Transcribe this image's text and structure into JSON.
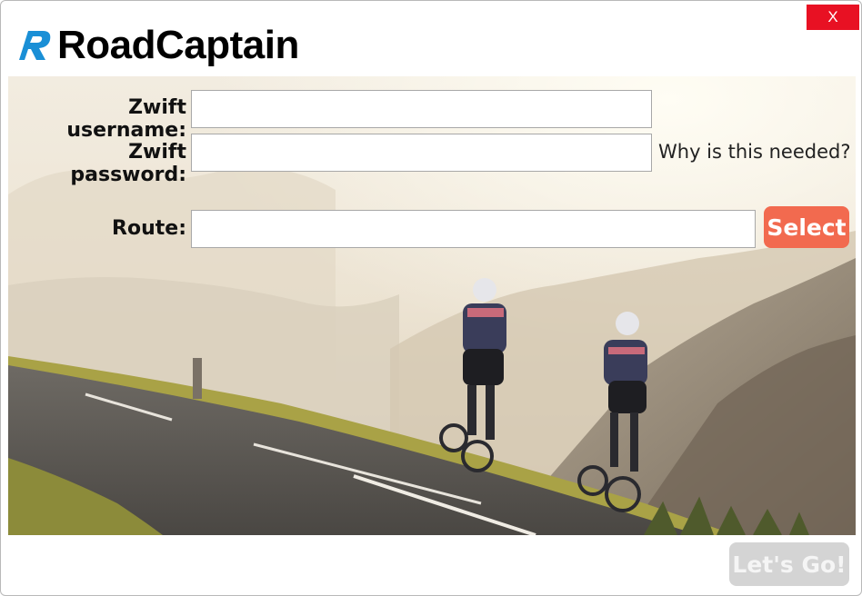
{
  "window": {
    "close_label": "X"
  },
  "brand": {
    "name": "RoadCaptain",
    "logo_icon": "roadcaptain-r-logo",
    "logo_color": "#1a8fd6"
  },
  "form": {
    "username_label": "Zwift username:",
    "username_value": "",
    "password_label": "Zwift password:",
    "password_value": "",
    "why_link": "Why is this needed?",
    "route_label": "Route:",
    "route_value": "",
    "select_button": "Select",
    "select_color": "#f26a4f"
  },
  "footer": {
    "go_button": "Let's Go!",
    "go_enabled": false
  },
  "hero": {
    "image": "two cyclists riding uphill on a mountain road",
    "icon": "hero-cycling-image"
  }
}
